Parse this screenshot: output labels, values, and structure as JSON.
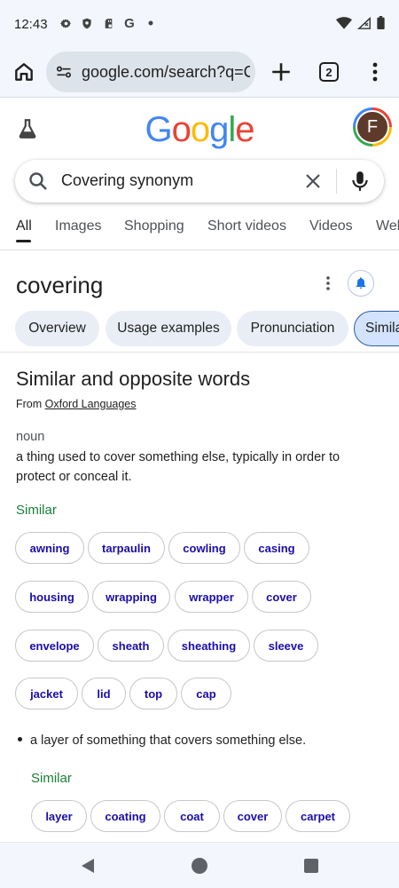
{
  "status_bar": {
    "time": "12:43",
    "left_icons": [
      "gear-icon",
      "shield-icon",
      "sd-card-icon",
      "g-icon",
      "dot-icon"
    ],
    "right_icons": [
      "wifi-icon",
      "signal-icon",
      "battery-icon"
    ]
  },
  "toolbar": {
    "url": "google.com/search?q=C",
    "tab_count": "2"
  },
  "google": {
    "logo_letters": [
      "G",
      "o",
      "o",
      "g",
      "l",
      "e"
    ],
    "logo_colors": [
      "#4285f4",
      "#ea4335",
      "#fbbc05",
      "#4285f4",
      "#34a853",
      "#ea4335"
    ],
    "avatar_letter": "F"
  },
  "search": {
    "query": "Covering synonym"
  },
  "search_tabs": [
    "All",
    "Images",
    "Shopping",
    "Short videos",
    "Videos",
    "Web"
  ],
  "word": {
    "title": "covering"
  },
  "section_chips": [
    "Overview",
    "Usage examples",
    "Pronunciation",
    "Simila"
  ],
  "similar_section": {
    "heading": "Similar and opposite words",
    "source_prefix": "From",
    "source_link": "Oxford Languages",
    "part_of_speech": "noun",
    "definition_1": "a thing used to cover something else, typically in order to protect or conceal it.",
    "similar_label": "Similar",
    "chips_1": [
      [
        "awning",
        "tarpaulin",
        "cowling",
        "casing"
      ],
      [
        "housing",
        "wrapping",
        "wrapper",
        "cover"
      ],
      [
        "envelope",
        "sheath",
        "sheathing",
        "sleeve"
      ],
      [
        "jacket",
        "lid",
        "top",
        "cap"
      ]
    ],
    "definition_2": "a layer of something that covers something else.",
    "similar_label_2": "Similar",
    "chips_2": [
      "layer",
      "coating",
      "coat",
      "cover",
      "carpet"
    ]
  },
  "colors": {
    "accent_blue": "#1a0dab",
    "similar_green": "#188038",
    "chip_bg": "#e9eef6"
  }
}
